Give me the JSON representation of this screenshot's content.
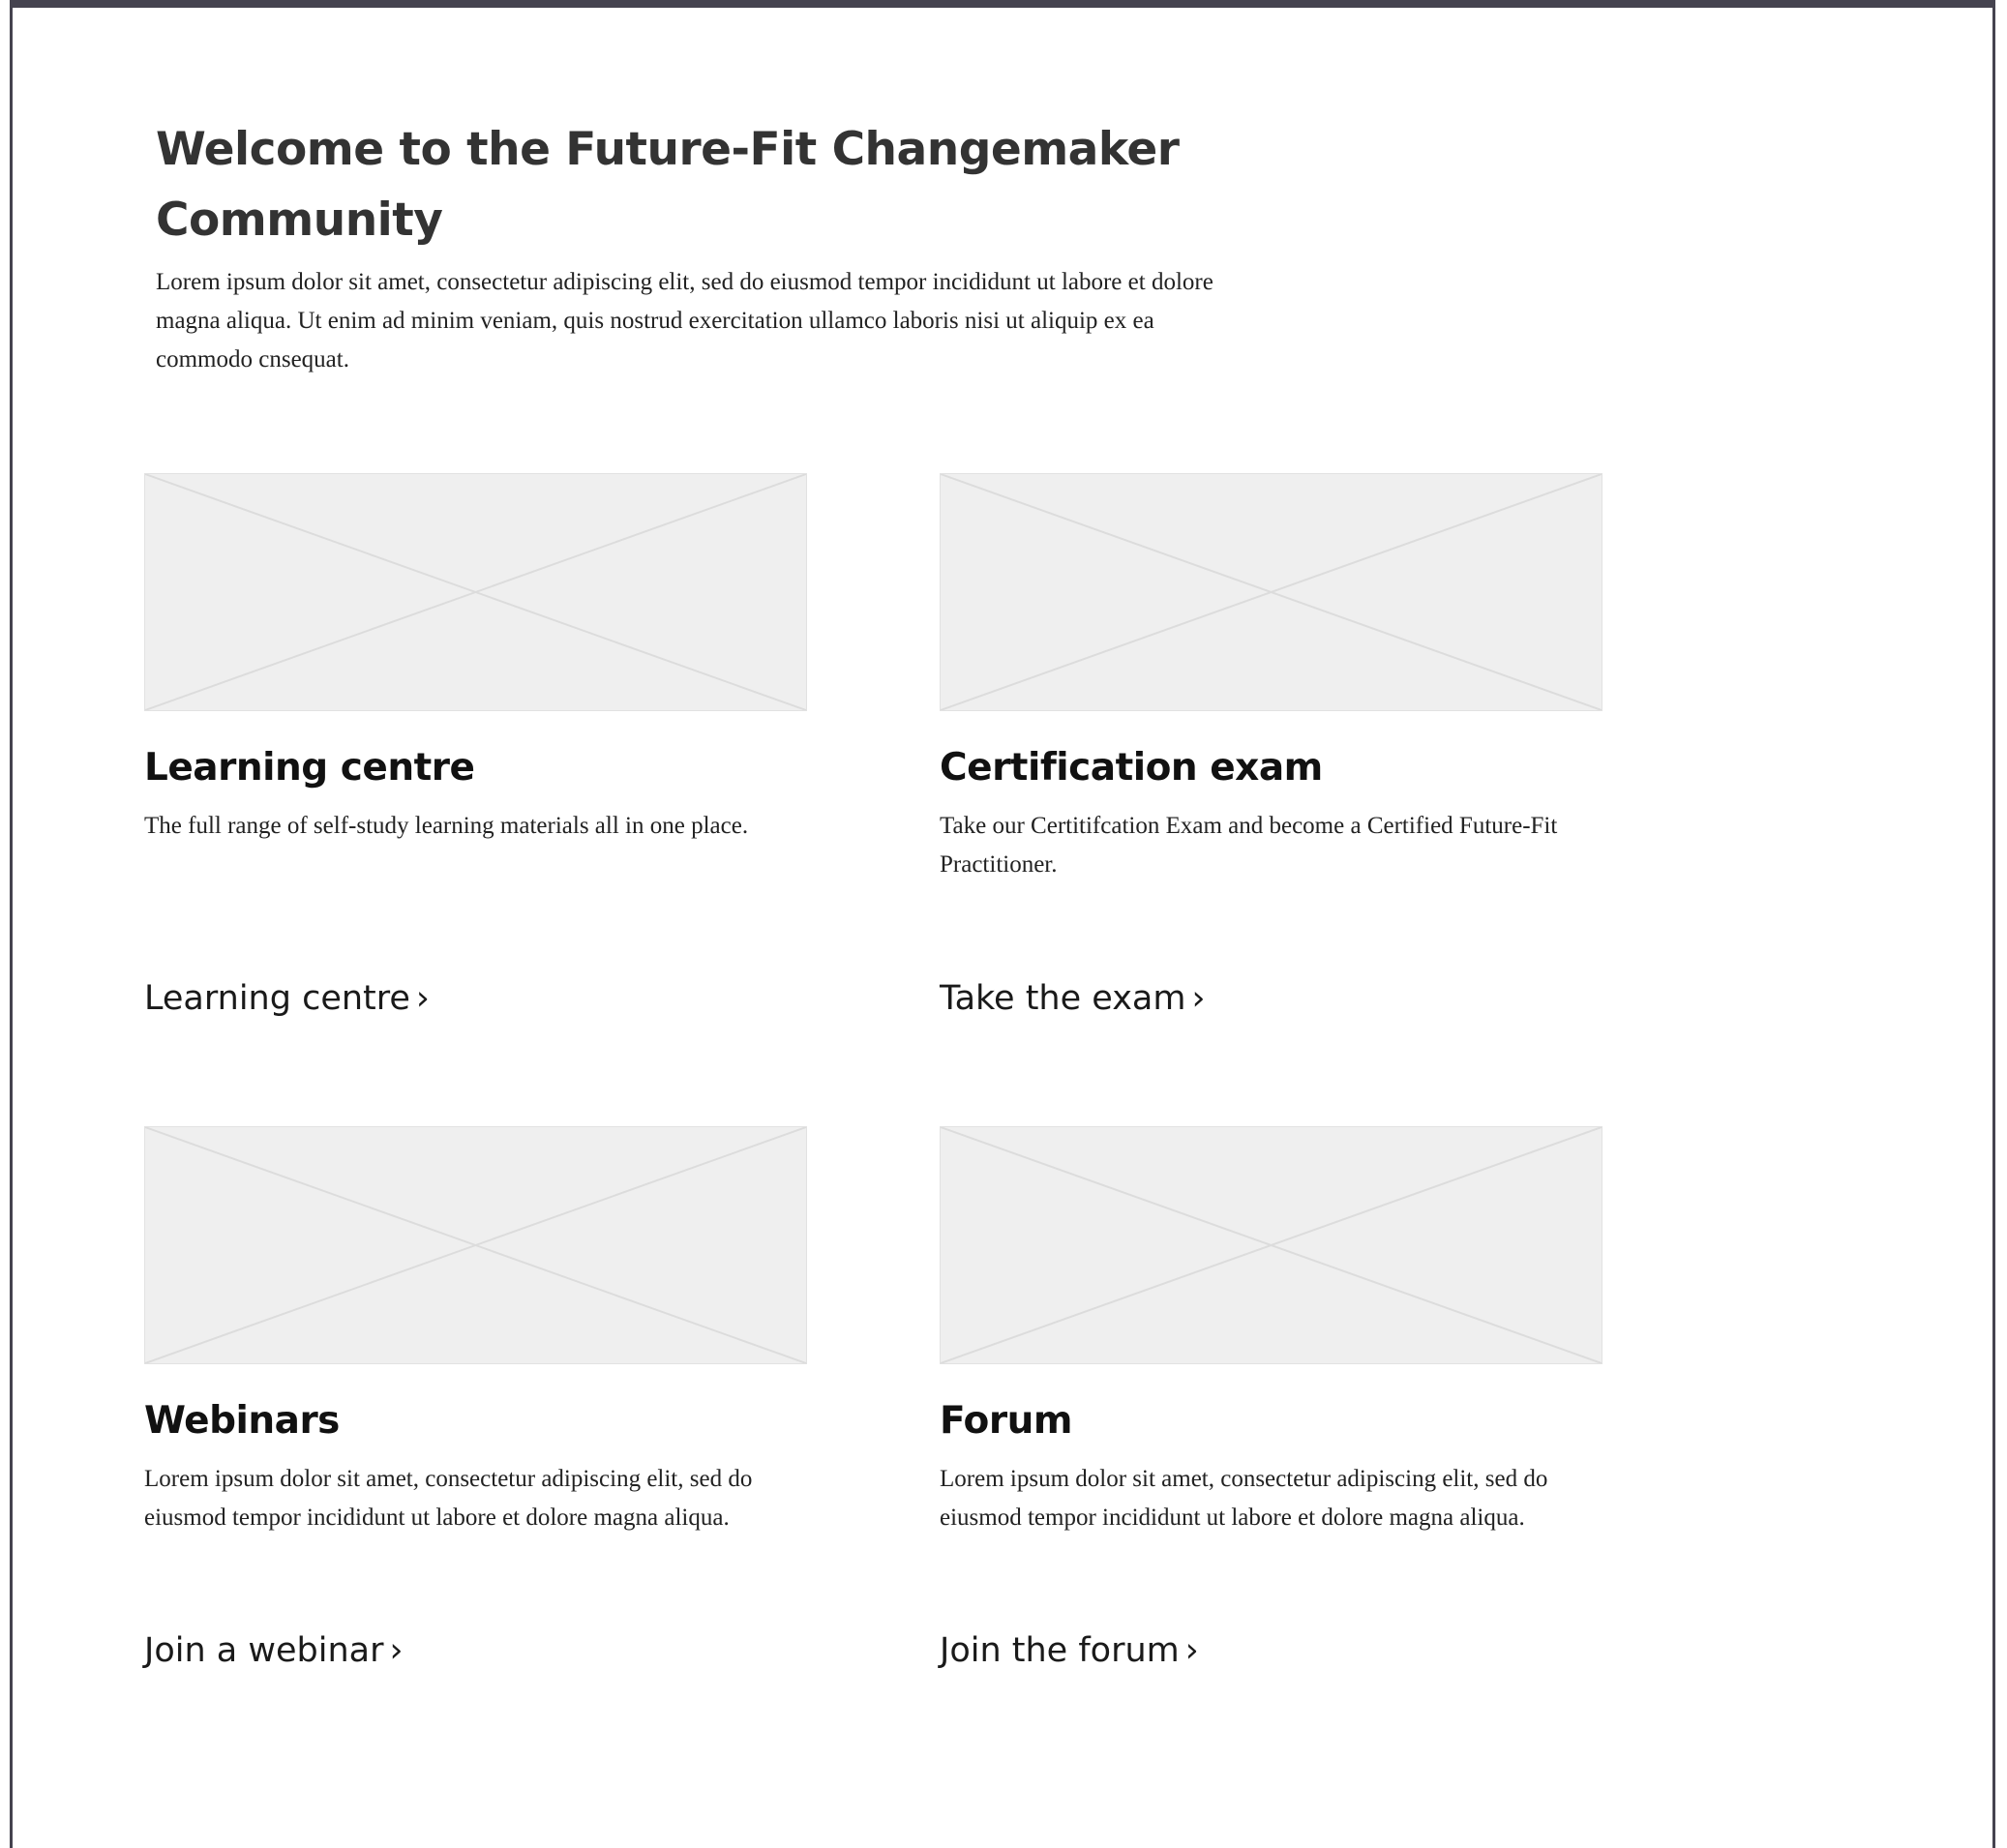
{
  "header": {
    "title": "Welcome to the Future-Fit Changemaker Community",
    "intro": "Lorem ipsum dolor sit amet, consectetur adipiscing elit, sed do eiusmod tempor incididunt ut labore et dolore magna aliqua. Ut enim ad minim veniam, quis nostrud exercitation ullamco laboris nisi ut aliquip ex ea commodo cnsequat."
  },
  "cards": [
    {
      "title": "Learning centre",
      "description": "The full range of self-study learning materials all in one place.",
      "link_label": "Learning centre",
      "link_icon": "›"
    },
    {
      "title": "Certification exam",
      "description": "Take our Certitifcation Exam and become a Certified Future-Fit Practitioner.",
      "link_label": "Take the exam",
      "link_icon": "›"
    },
    {
      "title": "Webinars",
      "description": "Lorem ipsum dolor sit amet, consectetur adipiscing elit, sed do eiusmod tempor incididunt ut labore et dolore magna aliqua.",
      "link_label": "Join a webinar",
      "link_icon": "›"
    },
    {
      "title": "Forum",
      "description": "Lorem ipsum dolor sit amet, consectetur adipiscing elit, sed do eiusmod tempor incididunt ut labore et dolore magna aliqua.",
      "link_label": "Join the forum",
      "link_icon": "›"
    }
  ],
  "colors": {
    "frame": "#45434f",
    "placeholder_fill": "#efefef",
    "placeholder_line": "#dcdcdc",
    "heading": "#333333",
    "text": "#222222"
  }
}
